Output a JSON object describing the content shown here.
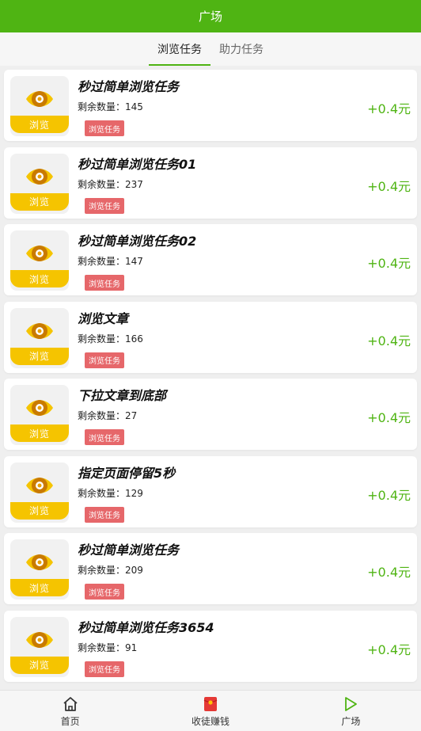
{
  "header": {
    "title": "广场"
  },
  "tabs": [
    {
      "label": "浏览任务",
      "active": true
    },
    {
      "label": "助力任务",
      "active": false
    }
  ],
  "thumb_label": "浏览",
  "remain_prefix": "剩余数量：",
  "tasks": [
    {
      "title": "秒过简单浏览任务",
      "remain": "145",
      "tag": "浏览任务",
      "reward": "+0.4元"
    },
    {
      "title": "秒过简单浏览任务01",
      "remain": "237",
      "tag": "浏览任务",
      "reward": "+0.4元"
    },
    {
      "title": "秒过简单浏览任务02",
      "remain": "147",
      "tag": "浏览任务",
      "reward": "+0.4元"
    },
    {
      "title": "浏览文章",
      "remain": "166",
      "tag": "浏览任务",
      "reward": "+0.4元"
    },
    {
      "title": "下拉文章到底部",
      "remain": "27",
      "tag": "浏览任务",
      "reward": "+0.4元"
    },
    {
      "title": "指定页面停留5秒",
      "remain": "129",
      "tag": "浏览任务",
      "reward": "+0.4元"
    },
    {
      "title": "秒过简单浏览任务",
      "remain": "209",
      "tag": "浏览任务",
      "reward": "+0.4元"
    },
    {
      "title": "秒过简单浏览任务3654",
      "remain": "91",
      "tag": "浏览任务",
      "reward": "+0.4元"
    }
  ],
  "bottom_nav": [
    {
      "label": "首页",
      "icon": "home-icon"
    },
    {
      "label": "收徒赚钱",
      "icon": "red-envelope-icon"
    },
    {
      "label": "广场",
      "icon": "play-icon"
    }
  ],
  "colors": {
    "brand_green": "#4fb413",
    "tag_red": "#e6676a",
    "thumb_yellow": "#f5c400"
  }
}
